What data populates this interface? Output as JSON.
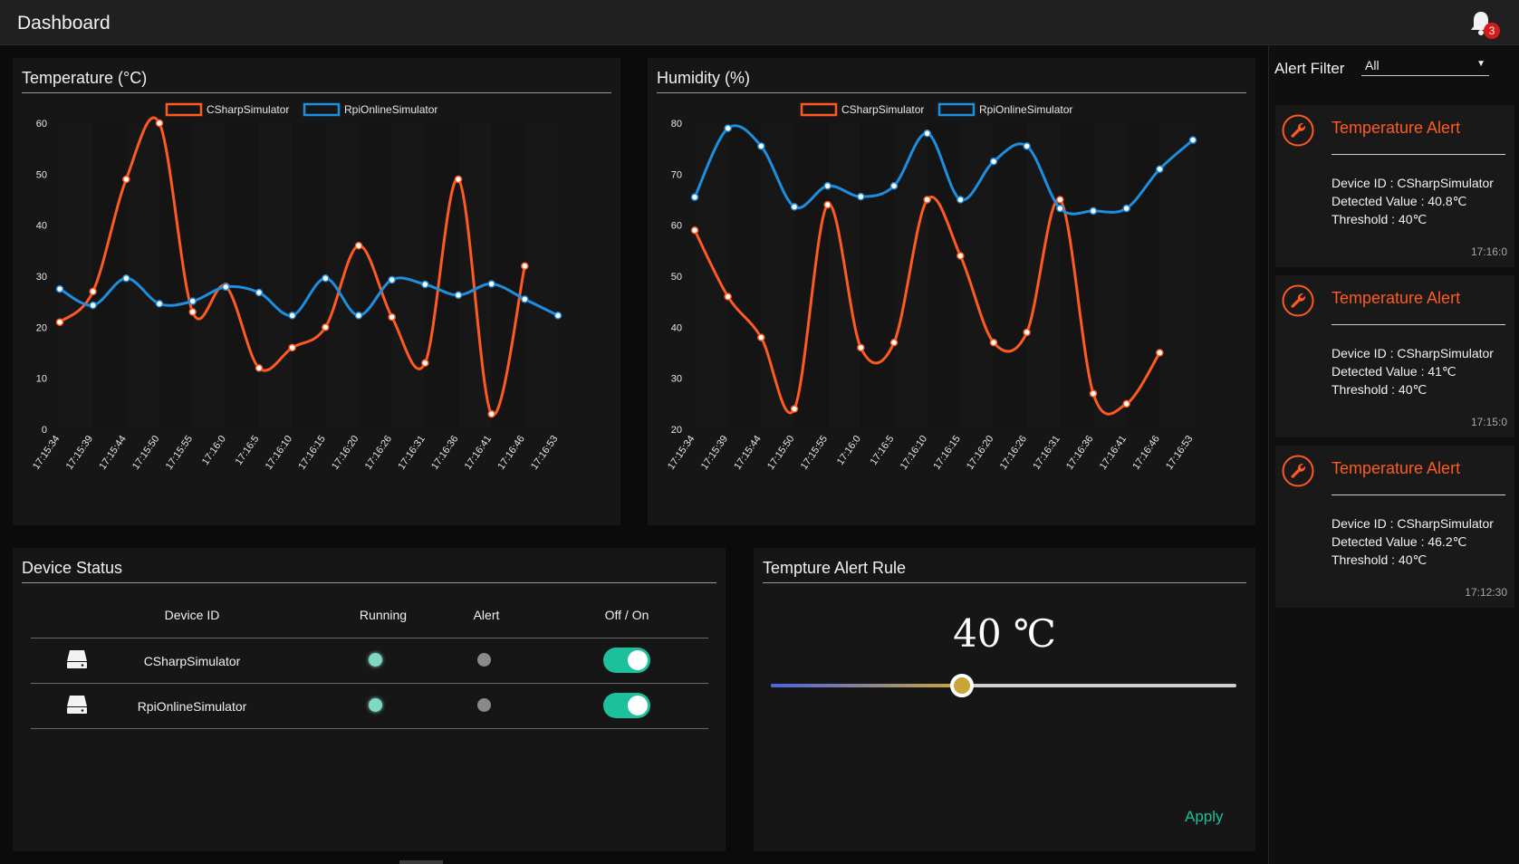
{
  "header": {
    "title": "Dashboard",
    "notification_count": "3"
  },
  "temperature_panel": {
    "title": "Temperature (°C)"
  },
  "humidity_panel": {
    "title": "Humidity (%)"
  },
  "chart_data": [
    {
      "type": "line",
      "title": "Temperature (°C)",
      "x": [
        "17:15:34",
        "17:15:39",
        "17:15:44",
        "17:15:50",
        "17:15:55",
        "17:16:0",
        "17:16:5",
        "17:16:10",
        "17:16:15",
        "17:16:20",
        "17:16:26",
        "17:16:31",
        "17:16:36",
        "17:16:41",
        "17:16:46",
        "17:16:53"
      ],
      "ylim": [
        0,
        60
      ],
      "yticks": [
        0,
        10,
        20,
        30,
        40,
        50,
        60
      ],
      "legend": "top-center",
      "series": [
        {
          "name": "CSharpSimulator",
          "color": "#ff5a1f",
          "points": [
            [
              0,
              21
            ],
            [
              1,
              27
            ],
            [
              2,
              49
            ],
            [
              3,
              60
            ],
            [
              4,
              23
            ],
            [
              5,
              28
            ],
            [
              6,
              12
            ],
            [
              7,
              16
            ],
            [
              8,
              20
            ],
            [
              9,
              36
            ],
            [
              10,
              22
            ],
            [
              11,
              13
            ],
            [
              12,
              49
            ],
            [
              13,
              3
            ],
            [
              14,
              32
            ]
          ]
        },
        {
          "name": "RpiOnlineSimulator",
          "color": "#1e8fe0",
          "points": [
            [
              0,
              27.5
            ],
            [
              1,
              24.3
            ],
            [
              2,
              29.6
            ],
            [
              3,
              24.6
            ],
            [
              4,
              25.1
            ],
            [
              5,
              27.9
            ],
            [
              6,
              26.8
            ],
            [
              7,
              22.3
            ],
            [
              8,
              29.6
            ],
            [
              9,
              22.3
            ],
            [
              10,
              29.3
            ],
            [
              11,
              28.4
            ],
            [
              12,
              26.3
            ],
            [
              13,
              28.5
            ],
            [
              14,
              25.5
            ],
            [
              15,
              22.3
            ]
          ]
        }
      ]
    },
    {
      "type": "line",
      "title": "Humidity (%)",
      "x": [
        "17:15:34",
        "17:15:39",
        "17:15:44",
        "17:15:50",
        "17:15:55",
        "17:16:0",
        "17:16:5",
        "17:16:10",
        "17:16:15",
        "17:16:20",
        "17:16:26",
        "17:16:31",
        "17:16:36",
        "17:16:41",
        "17:16:46",
        "17:16:53"
      ],
      "ylim": [
        20,
        80
      ],
      "yticks": [
        20,
        30,
        40,
        50,
        60,
        70,
        80
      ],
      "legend": "top-center",
      "series": [
        {
          "name": "CSharpSimulator",
          "color": "#ff5a1f",
          "points": [
            [
              0,
              59
            ],
            [
              1,
              46
            ],
            [
              2,
              38
            ],
            [
              3,
              24
            ],
            [
              4,
              64
            ],
            [
              5,
              36
            ],
            [
              6,
              37
            ],
            [
              7,
              65
            ],
            [
              8,
              54
            ],
            [
              9,
              37
            ],
            [
              10,
              39
            ],
            [
              11,
              65
            ],
            [
              12,
              27
            ],
            [
              13,
              25
            ],
            [
              14,
              35
            ]
          ]
        },
        {
          "name": "RpiOnlineSimulator",
          "color": "#1e8fe0",
          "points": [
            [
              0,
              65.5
            ],
            [
              1,
              79
            ],
            [
              2,
              75.5
            ],
            [
              3,
              63.6
            ],
            [
              4,
              67.7
            ],
            [
              5,
              65.6
            ],
            [
              6,
              67.7
            ],
            [
              7,
              78
            ],
            [
              8,
              65
            ],
            [
              9,
              72.5
            ],
            [
              10,
              75.5
            ],
            [
              11,
              63.3
            ],
            [
              12,
              62.8
            ],
            [
              13,
              63.3
            ],
            [
              14,
              71
            ],
            [
              15,
              76.7
            ]
          ]
        }
      ]
    }
  ],
  "device_status": {
    "title": "Device Status",
    "columns": [
      "Device ID",
      "Running",
      "Alert",
      "Off / On"
    ],
    "rows": [
      {
        "id": "CSharpSimulator",
        "running": true,
        "alert": false,
        "on": true
      },
      {
        "id": "RpiOnlineSimulator",
        "running": true,
        "alert": false,
        "on": true
      }
    ]
  },
  "alert_rule": {
    "title": "Tempture Alert Rule",
    "value": "40 ℃",
    "slider_fraction": 0.41,
    "apply_label": "Apply"
  },
  "sidebar": {
    "filter_label": "Alert Filter",
    "filter_value": "All",
    "alerts": [
      {
        "title": "Temperature Alert",
        "device": "Device ID : CSharpSimulator",
        "value": "Detected Value : 40.8℃",
        "threshold": "Threshold : 40℃",
        "time": "17:16:0"
      },
      {
        "title": "Temperature Alert",
        "device": "Device ID : CSharpSimulator",
        "value": "Detected Value : 41℃",
        "threshold": "Threshold : 40℃",
        "time": "17:15:0"
      },
      {
        "title": "Temperature Alert",
        "device": "Device ID : CSharpSimulator",
        "value": "Detected Value : 46.2℃",
        "threshold": "Threshold : 40℃",
        "time": "17:12:30"
      }
    ]
  }
}
